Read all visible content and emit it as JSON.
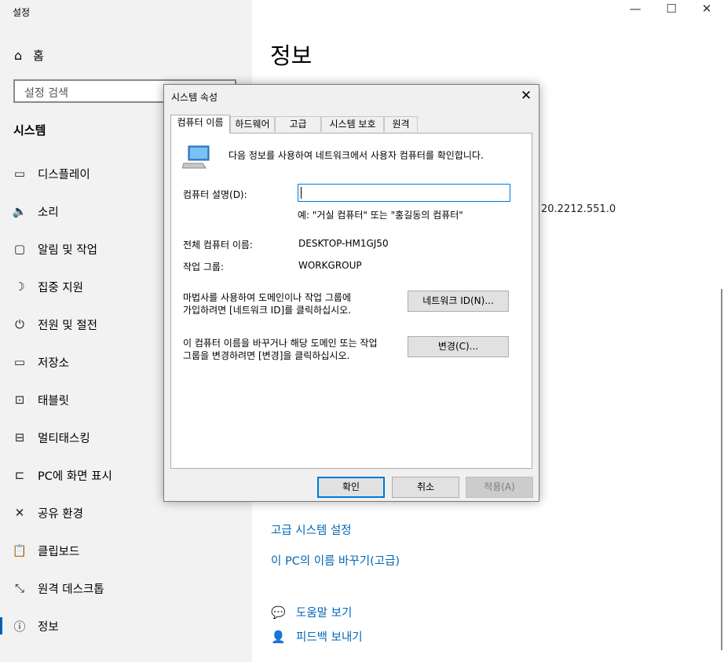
{
  "app_title": "설정",
  "window": {
    "minimize": "—",
    "maximize": "☐",
    "close": "✕"
  },
  "sidebar": {
    "home_label": "홈",
    "search_placeholder": "설정 검색",
    "section_title": "시스템",
    "items": [
      {
        "label": "디스플레이",
        "icon": "display-icon",
        "glyph": "▭"
      },
      {
        "label": "소리",
        "icon": "speaker-icon",
        "glyph": "🔈"
      },
      {
        "label": "알림 및 작업",
        "icon": "notification-icon",
        "glyph": "▢"
      },
      {
        "label": "집중 지원",
        "icon": "moon-icon",
        "glyph": "☽"
      },
      {
        "label": "전원 및 절전",
        "icon": "power-icon",
        "glyph": "⏻"
      },
      {
        "label": "저장소",
        "icon": "storage-icon",
        "glyph": "▭"
      },
      {
        "label": "태블릿",
        "icon": "tablet-icon",
        "glyph": "⊡"
      },
      {
        "label": "멀티태스킹",
        "icon": "multitasking-icon",
        "glyph": "⊟"
      },
      {
        "label": "PC에 화면 표시",
        "icon": "project-icon",
        "glyph": "⊏"
      },
      {
        "label": "공유 환경",
        "icon": "share-icon",
        "glyph": "✕"
      },
      {
        "label": "클립보드",
        "icon": "clipboard-icon",
        "glyph": "📋"
      },
      {
        "label": "원격 데스크톱",
        "icon": "remote-desktop-icon",
        "glyph": "⤡"
      },
      {
        "label": "정보",
        "icon": "info-icon",
        "glyph": "ⓘ",
        "active": true
      }
    ]
  },
  "main": {
    "title": "정보",
    "version_fragment": "20.2212.551.0",
    "links": [
      "고급 시스템 설정",
      "이 PC의 이름 바꾸기(고급)"
    ],
    "help": [
      {
        "label": "도움말 보기",
        "icon": "help-icon",
        "glyph": "💬"
      },
      {
        "label": "피드백 보내기",
        "icon": "feedback-icon",
        "glyph": "👤"
      }
    ]
  },
  "dialog": {
    "title": "시스템 속성",
    "close": "✕",
    "tabs": [
      "컴퓨터 이름",
      "하드웨어",
      "고급",
      "시스템 보호",
      "원격"
    ],
    "intro": "다음 정보를 사용하여 네트워크에서 사용자 컴퓨터를 확인합니다.",
    "description_label": "컴퓨터 설명(D):",
    "description_value": "",
    "description_hint": "예: \"거실 컴퓨터\" 또는 \"홍길동의 컴퓨터\"",
    "full_name_label": "전체 컴퓨터 이름:",
    "full_name_value": "DESKTOP-HM1GJ50",
    "workgroup_label": "작업 그룹:",
    "workgroup_value": "WORKGROUP",
    "network_text_1": "마법사를 사용하여 도메인이나 작업 그룹에",
    "network_text_2": "가입하려면 [네트워크 ID]를 클릭하십시오.",
    "network_button": "네트워크 ID(N)...",
    "change_text_1": "이 컴퓨터 이름을 바꾸거나 해당 도메인 또는 작업",
    "change_text_2": "그룹을 변경하려면 [변경]을 클릭하십시오.",
    "change_button": "변경(C)...",
    "ok": "확인",
    "cancel": "취소",
    "apply": "적용(A)"
  }
}
